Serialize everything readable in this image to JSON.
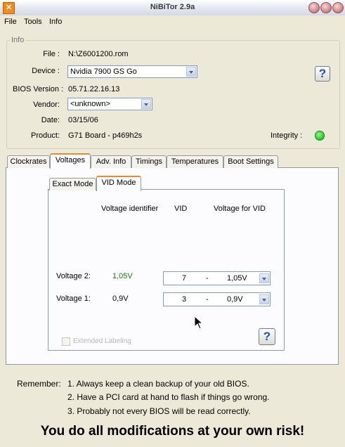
{
  "window": {
    "title": "NiBiTor 2.9a"
  },
  "menu": [
    "File",
    "Tools",
    "Info"
  ],
  "info": {
    "legend": "Info",
    "file_label": "File :",
    "file_value": "N:\\Z6001200.rom",
    "device_label": "Device :",
    "device_value": "Nvidia 7900 GS Go",
    "bios_label": "BIOS Version :",
    "bios_value": "05.71.22.16.13",
    "vendor_label": "Vendor:",
    "vendor_value": "<unknown>",
    "date_label": "Date:",
    "date_value": "03/15/06",
    "product_label": "Product:",
    "product_value": "G71 Board - p469h2s",
    "integrity_label": "Integrity :",
    "integrity_color": "#2fc42f",
    "help": "?"
  },
  "tabs": [
    "Clockrates",
    "Voltages",
    "Adv. Info",
    "Timings",
    "Temperatures",
    "Boot Settings"
  ],
  "active_tab": "Voltages",
  "subtabs": [
    "Exact Mode",
    "VID Mode"
  ],
  "active_subtab": "VID Mode",
  "vid": {
    "col_identifier": "Voltage identifier",
    "col_vid": "VID",
    "col_vfv": "Voltage for VID",
    "voltage2_label": "Voltage 2:",
    "voltage2_id": "1,05V",
    "voltage2_vid": "7",
    "voltage2_vfv": "1,05V",
    "voltage1_label": "Voltage 1:",
    "voltage1_id": "0,9V",
    "voltage1_vid": "3",
    "voltage1_vfv": "0,9V",
    "dash": "-",
    "extended_label": "Extended Labeling",
    "help": "?",
    "voltage2_color": "#1a7a1a"
  },
  "footer": {
    "remember": "Remember:",
    "line1": "1. Always keep a clean backup of your old BIOS.",
    "line2": "2. Have a PCI card at hand to flash if things go wrong.",
    "line3": "3. Probably not every BIOS will be read correctly.",
    "warning": "You do all modifications at your own risk!"
  }
}
